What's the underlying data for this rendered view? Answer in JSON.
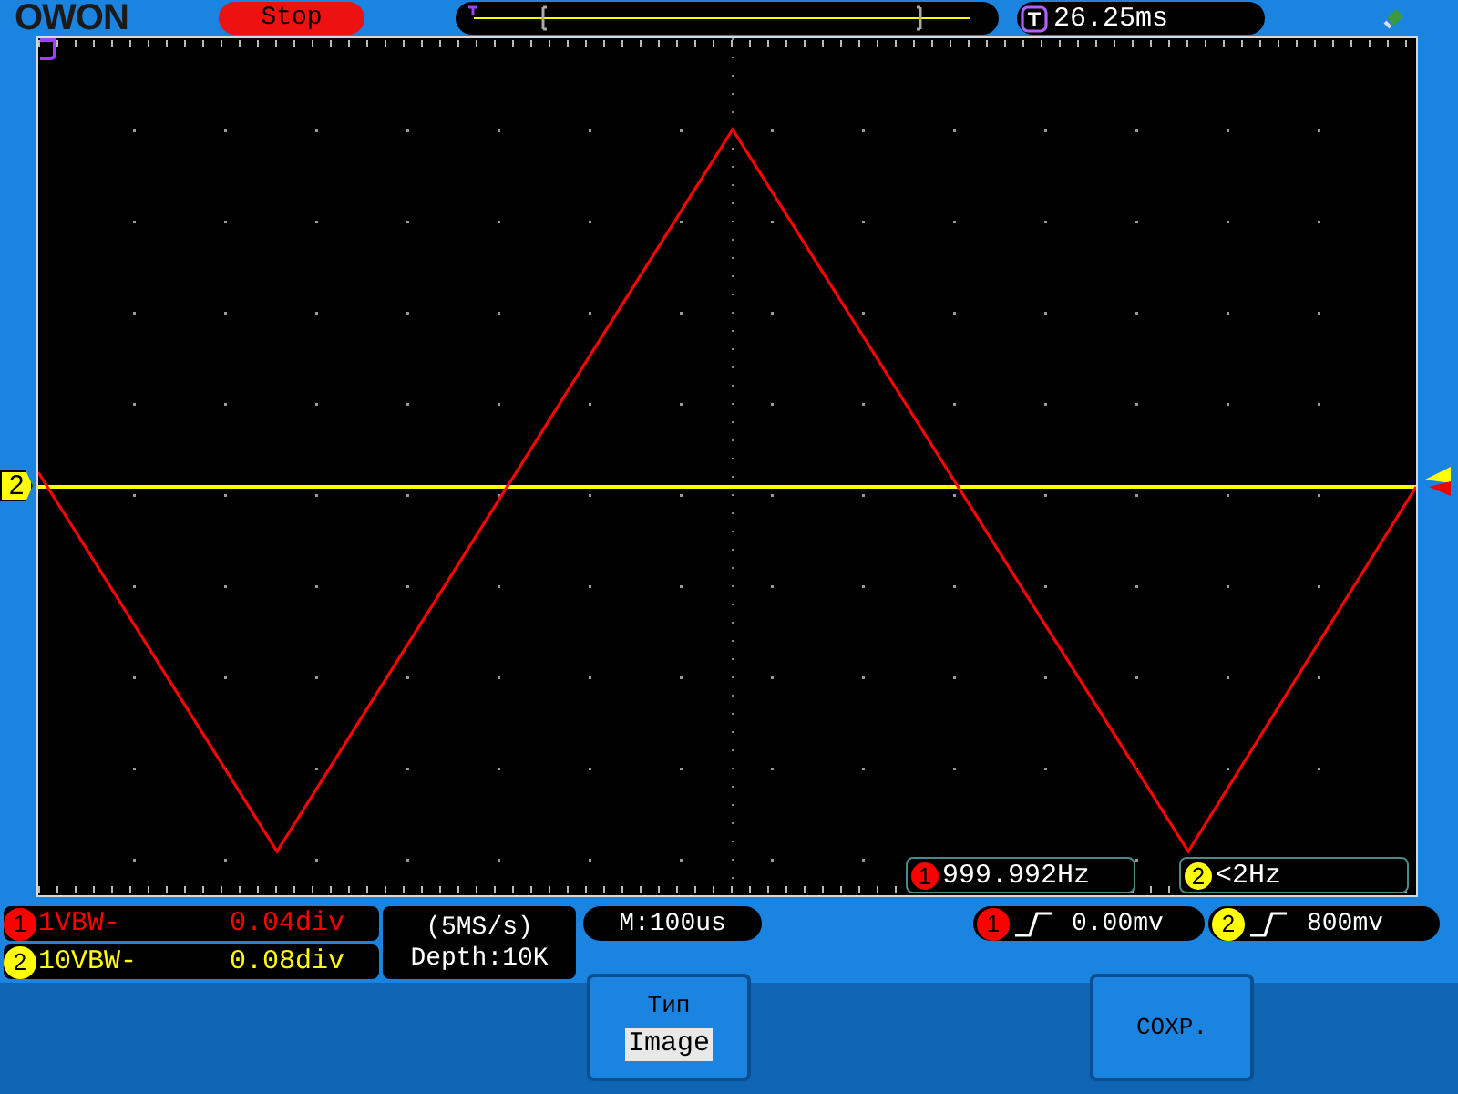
{
  "brand": "OWON",
  "run_state": "Stop",
  "trigger_time": "26.25ms",
  "trace_marker": {
    "label": "2",
    "color": "#ffff00"
  },
  "channels": [
    {
      "badge": "1",
      "coupling": "1VBW-",
      "value": "0.04div",
      "color": "#ff0000"
    },
    {
      "badge": "2",
      "coupling": "10VBW-",
      "value": "0.08div",
      "color": "#ffff00"
    }
  ],
  "acquisition": {
    "rate": "(5MS/s)",
    "depth": "Depth:10K"
  },
  "timebase": "M:100us",
  "frequencies": [
    {
      "badge": "1",
      "value": "999.992Hz",
      "color": "#ff0000"
    },
    {
      "badge": "2",
      "value": "<2Hz",
      "color": "#ffff00"
    }
  ],
  "triggers": [
    {
      "badge": "1",
      "value": "0.00mv",
      "color": "#ff0000"
    },
    {
      "badge": "2",
      "value": "800mv",
      "color": "#ffff00"
    }
  ],
  "menu": [
    {
      "kind": "option",
      "label": "Тип",
      "value": "Image"
    },
    {
      "kind": "action",
      "label": "СОХР."
    }
  ]
}
